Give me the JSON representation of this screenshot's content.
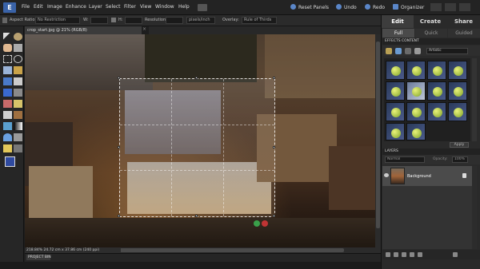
{
  "app": {
    "logo_text": "E"
  },
  "menus": [
    {
      "key": "file",
      "label": "File"
    },
    {
      "key": "edit",
      "label": "Edit"
    },
    {
      "key": "image",
      "label": "Image"
    },
    {
      "key": "enhance",
      "label": "Enhance"
    },
    {
      "key": "layer",
      "label": "Layer"
    },
    {
      "key": "select",
      "label": "Select"
    },
    {
      "key": "filter",
      "label": "Filter"
    },
    {
      "key": "view",
      "label": "View"
    },
    {
      "key": "window",
      "label": "Window"
    },
    {
      "key": "help",
      "label": "Help"
    }
  ],
  "top_actions": {
    "reset": "Reset Panels",
    "undo": "Undo",
    "redo": "Redo",
    "organizer": "Organizer"
  },
  "options": {
    "aspect_label": "Aspect Ratio:",
    "aspect_value": "No Restriction",
    "w_label": "W:",
    "h_label": "H:",
    "resolution_label": "Resolution:",
    "res_unit": "pixels/inch",
    "overlay_label": "Overlay:",
    "overlay_value": "Rule of Thirds"
  },
  "document": {
    "tab": "crop_start.jpg @ 21% (RGB/8)",
    "close": "×",
    "status": "218.84%   24.72 cm x 37.86 cm (240 ppi)",
    "project_bin": "PROJECT BIN"
  },
  "panel": {
    "tabs": {
      "edit": "Edit",
      "create": "Create",
      "share": "Share"
    },
    "subtabs": {
      "full": "Full",
      "quick": "Quick",
      "guided": "Guided"
    },
    "effects_title": "EFFECTS  CONTENT",
    "effects_filter": "Artistic",
    "apply": "Apply",
    "layers_title": "LAYERS",
    "blend_mode": "Normal",
    "opacity_label": "Opacity:",
    "opacity_value": "100%",
    "layer_name": "Background"
  },
  "colors": {
    "accent": "#3a63a8",
    "panel_tab_active": "#3d3d3d",
    "foreground": "#2f4aa0",
    "background": "#ffffff"
  }
}
